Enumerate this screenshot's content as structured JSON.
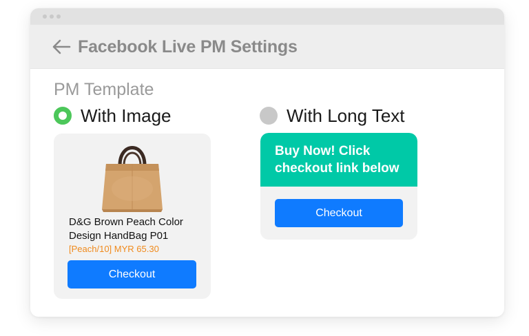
{
  "header": {
    "title": "Facebook Live PM Settings"
  },
  "section": {
    "label": "PM Template"
  },
  "options": {
    "with_image": {
      "label": "With Image",
      "selected": true
    },
    "with_long_text": {
      "label": "With Long Text",
      "selected": false
    }
  },
  "image_template": {
    "product_name": "D&G Brown Peach Color Design HandBag P01",
    "product_price": "[Peach/10] MYR 65.30",
    "checkout_label": "Checkout"
  },
  "text_template": {
    "message": "Buy Now! Click checkout link below",
    "checkout_label": "Checkout"
  },
  "colors": {
    "selected_radio": "#4cc75a",
    "unselected_radio": "#c8c8c8",
    "checkout_button": "#0f7bff",
    "message_bubble": "#00c9a7",
    "price_text": "#f08a1c"
  },
  "icons": [
    "back-arrow-icon",
    "handbag-image"
  ]
}
